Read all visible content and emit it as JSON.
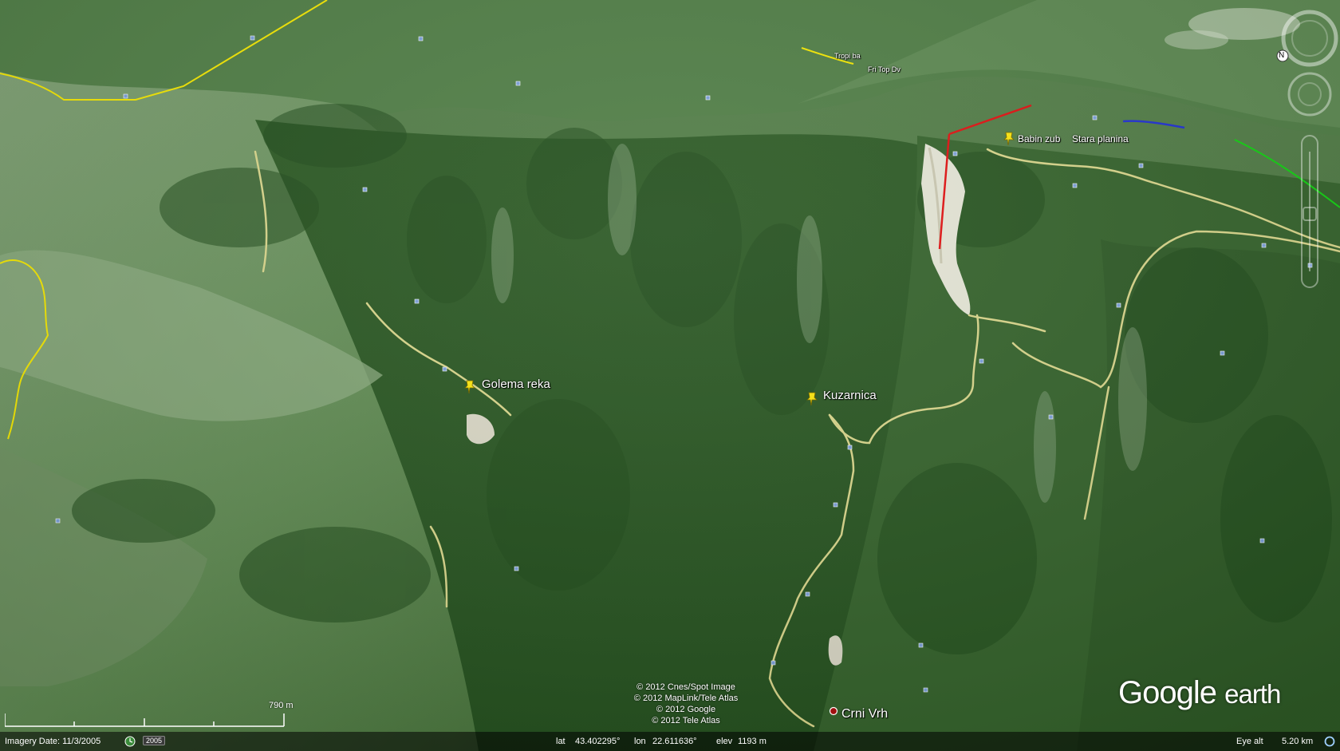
{
  "placemarks": {
    "golema_reka": "Golema reka",
    "kuzarnica": "Kuzarnica",
    "babin_zub": "Babin zub",
    "stara_planina": "Stara planina",
    "crni_vrh": "Crni Vrh",
    "top_left_small": "Tropi ba",
    "top_right_small": "Fri Top Dv"
  },
  "credits": [
    "© 2012 Cnes/Spot Image",
    "© 2012 MapLink/Tele Atlas",
    "© 2012 Google",
    "© 2012 Tele Atlas"
  ],
  "logo": {
    "google": "Google",
    "earth": "earth"
  },
  "scale": {
    "label": "790 m"
  },
  "status": {
    "imagery_date": "Imagery Date: 11/3/2005",
    "history_year": "2005",
    "lat_label": "lat",
    "lat": "43.402295°",
    "lon_label": "lon",
    "lon": "22.611636°",
    "elev_label": "elev",
    "elev": "1193 m",
    "eye_alt_label": "Eye alt",
    "eye_alt": "5.20 km"
  },
  "nav": {
    "north": "N"
  },
  "colors": {
    "border_yellow": "#f2e600",
    "route_red": "#e01010",
    "route_blue": "#2030d0",
    "route_green": "#10d010",
    "road": "#d8d58a",
    "pin": "#f5e11a"
  }
}
